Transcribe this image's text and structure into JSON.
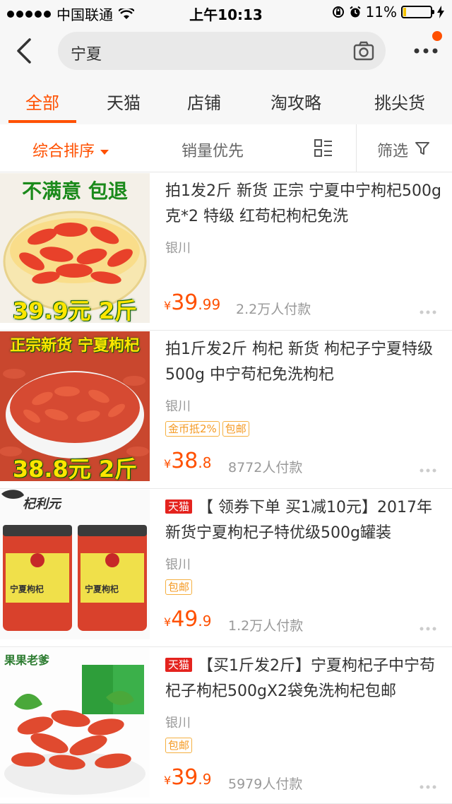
{
  "status_bar": {
    "carrier": "中国联通",
    "time": "上午10:13",
    "battery": "11%",
    "battery_level": 0.11
  },
  "search": {
    "query": "宁夏"
  },
  "tabs": [
    {
      "label": "全部",
      "active": true
    },
    {
      "label": "天猫"
    },
    {
      "label": "店铺"
    },
    {
      "label": "淘攻略"
    },
    {
      "label": "挑尖货"
    }
  ],
  "sort": {
    "comprehensive": "综合排序",
    "sales_first": "销量优先",
    "filter": "筛选"
  },
  "products": [
    {
      "thumb_top": "不满意 包退",
      "thumb_bottom": "39.9元 2斤",
      "title": "拍1发2斤 新货 正宗 宁夏中宁枸杞500g克*2 特级 红苟杞枸杞免洗",
      "tmall": "",
      "location": "银川",
      "badges": [],
      "price_symbol": "¥",
      "price_int": "39",
      "price_dec": ".99",
      "sales": "2.2万人付款"
    },
    {
      "thumb_top": "正宗新货 宁夏枸杞",
      "thumb_bottom": "38.8元 2斤",
      "title": "拍1斤发2斤 枸杞 新货 枸杞子宁夏特级 500g 中宁苟杞免洗枸杞",
      "tmall": "",
      "location": "银川",
      "badges": [
        "金币抵2%",
        "包邮"
      ],
      "price_symbol": "¥",
      "price_int": "38",
      "price_dec": ".8",
      "sales": "8772人付款"
    },
    {
      "thumb_top": "杞利元",
      "thumb_bottom": "",
      "thumb_label": "宁夏枸杞",
      "title": "【 领券下单 买1减10元】2017年新货宁夏枸杞子特优级500g罐装",
      "tmall": "天猫",
      "location": "银川",
      "badges": [
        "包邮"
      ],
      "price_symbol": "¥",
      "price_int": "49",
      "price_dec": ".9",
      "sales": "1.2万人付款"
    },
    {
      "thumb_top": "果果老爹",
      "thumb_bottom": "",
      "title": "【买1斤发2斤】宁夏枸杞子中宁苟杞子枸杞500gX2袋免洗枸杞包邮",
      "tmall": "天猫",
      "location": "银川",
      "badges": [
        "包邮"
      ],
      "price_symbol": "¥",
      "price_int": "39",
      "price_dec": ".9",
      "sales": "5979人付款"
    }
  ],
  "colors": {
    "accent": "#ff5000",
    "tmall_red": "#e4231e",
    "badge": "#f59a23"
  },
  "icons": [
    "back-icon",
    "camera-icon",
    "more-icon",
    "layout-toggle-icon",
    "filter-icon",
    "wifi-icon",
    "lock-rotation-icon",
    "alarm-icon",
    "charging-icon"
  ]
}
